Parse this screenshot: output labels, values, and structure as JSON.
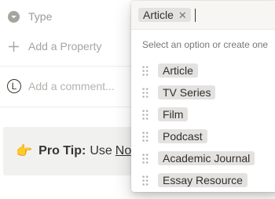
{
  "properties": {
    "type_label": "Type",
    "add_property_label": "Add a Property"
  },
  "comment": {
    "avatar_letter": "L",
    "placeholder": "Add a comment..."
  },
  "callout": {
    "emoji": "👉",
    "bold": "Pro Tip:",
    "text": "Use",
    "link": "No"
  },
  "dropdown": {
    "selected_chip": "Article",
    "hint": "Select an option or create one",
    "options": [
      {
        "label": "Article"
      },
      {
        "label": "TV Series"
      },
      {
        "label": "Film"
      },
      {
        "label": "Podcast"
      },
      {
        "label": "Academic Journal"
      },
      {
        "label": "Essay Resource"
      }
    ]
  },
  "icons": {
    "type": "chevron-down-circle-icon",
    "add": "plus-icon",
    "remove": "close-icon",
    "drag": "drag-handle-icon"
  },
  "colors": {
    "chip_background": "#e3e2e0",
    "input_background": "#f7f6f3",
    "callout_background": "#f1f1ef",
    "muted_text": "#9b9a97"
  }
}
